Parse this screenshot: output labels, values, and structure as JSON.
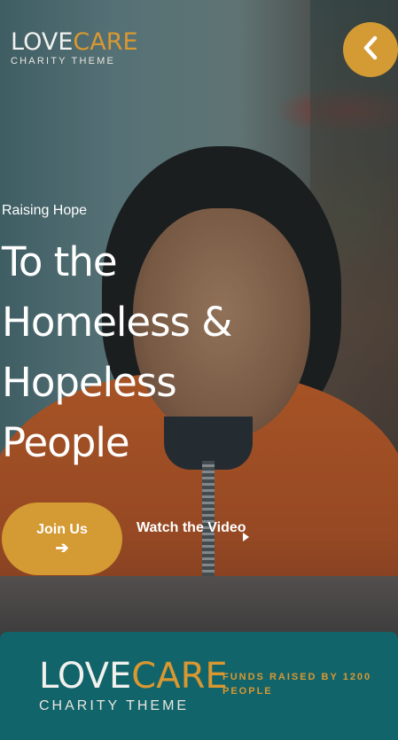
{
  "brand": {
    "love": "LOVE",
    "care": "CARE",
    "tagline": "CHARITY THEME"
  },
  "header": {
    "back_icon": "chevron-left-icon"
  },
  "hero": {
    "eyebrow": "Raising Hope",
    "headline": "To the Homeless & Hopeless People",
    "join_label": "Join Us",
    "join_icon": "arrow-right-icon",
    "video_label": "Watch the Video",
    "video_icon": "play-icon"
  },
  "footer": {
    "funds_text": "FUNDS RAISED BY 1200 PEOPLE"
  },
  "colors": {
    "accent": "#d49a33",
    "footer_bg": "#12646b",
    "text_light": "#ffffff"
  }
}
